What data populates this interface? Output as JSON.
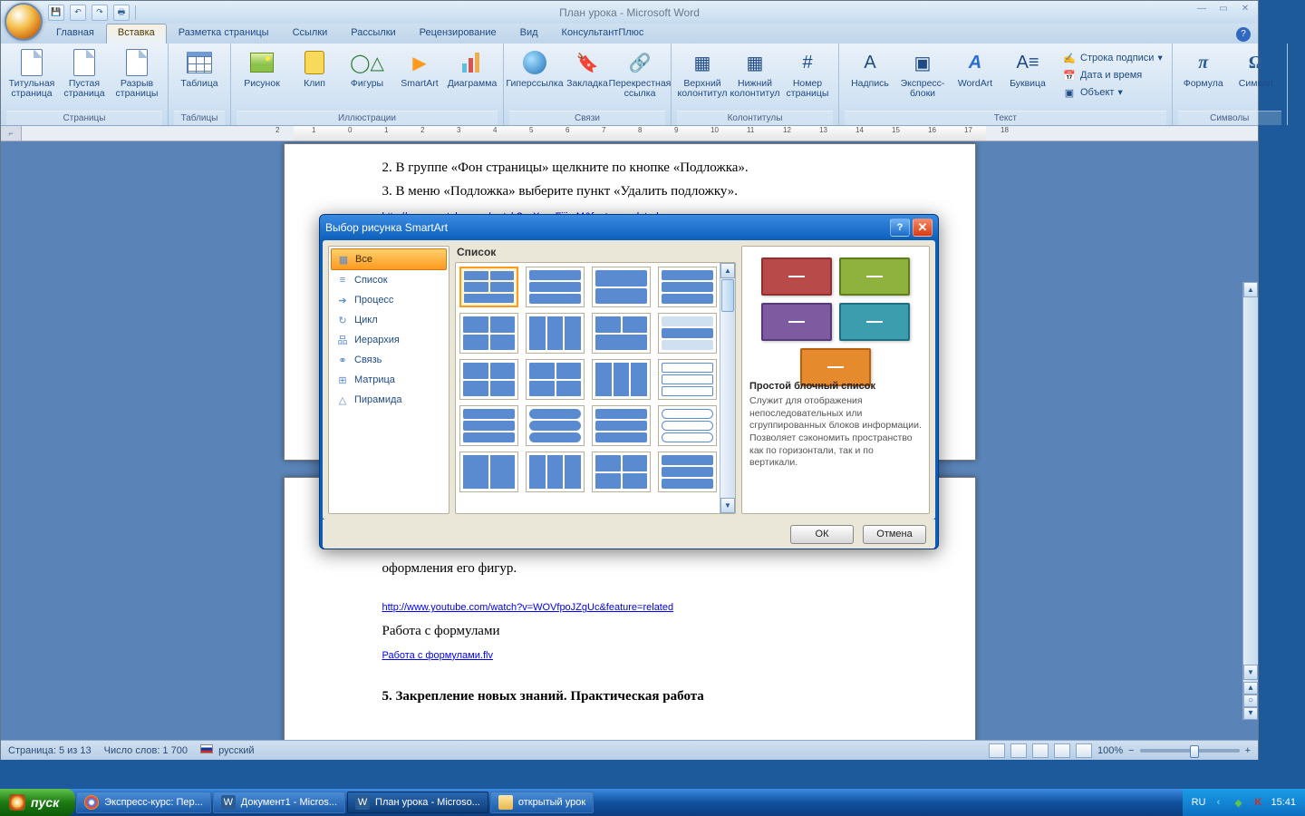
{
  "window": {
    "title": "План урока - Microsoft Word"
  },
  "qat": {
    "save": "💾",
    "undo": "↶",
    "redo": "↷",
    "print": "🖶"
  },
  "tabs": [
    "Главная",
    "Вставка",
    "Разметка страницы",
    "Ссылки",
    "Рассылки",
    "Рецензирование",
    "Вид",
    "КонсультантПлюс"
  ],
  "active_tab": 1,
  "ribbon": {
    "groups": {
      "pages": {
        "label": "Страницы",
        "items": [
          "Титульная страница",
          "Пустая страница",
          "Разрыв страницы"
        ]
      },
      "tables": {
        "label": "Таблицы",
        "items": [
          "Таблица"
        ]
      },
      "illus": {
        "label": "Иллюстрации",
        "items": [
          "Рисунок",
          "Клип",
          "Фигуры",
          "SmartArt",
          "Диаграмма"
        ]
      },
      "links": {
        "label": "Связи",
        "items": [
          "Гиперссылка",
          "Закладка",
          "Перекрестная ссылка"
        ]
      },
      "headerfooter": {
        "label": "Колонтитулы",
        "items": [
          "Верхний колонтитул",
          "Нижний колонтитул",
          "Номер страницы"
        ]
      },
      "text": {
        "label": "Текст",
        "items": [
          "Надпись",
          "Экспресс-блоки",
          "WordArt",
          "Буквица"
        ],
        "small": [
          "Строка подписи",
          "Дата и время",
          "Объект"
        ]
      },
      "symbols": {
        "label": "Символы",
        "items": [
          "Формула",
          "Символ"
        ]
      }
    }
  },
  "document": {
    "lines": [
      "2. В группе «Фон страницы» щелкните по кнопке «Подложка».",
      "3. В меню «Подложка» выберите пункт «Удалить подложку»."
    ],
    "link1": "http://www.youtube.com/watch?v=XsosFjijxrM&feature=related",
    "after_dialog": "оформления его фигур.",
    "link2": "http://www.youtube.com/watch?v=WOVfpoJZgUc&feature=related",
    "p3": "Работа с формулами",
    "link3": " Работа с формулами.flv",
    "p5": "5. Закрепление новых знаний. Практическая работа"
  },
  "dialog": {
    "title": "Выбор рисунка SmartArt",
    "categories": [
      "Все",
      "Список",
      "Процесс",
      "Цикл",
      "Иерархия",
      "Связь",
      "Матрица",
      "Пирамида"
    ],
    "gallery_title": "Список",
    "preview_title": "Простой блочный список",
    "preview_desc": "Служит для отображения непоследовательных или сгруппированных блоков информации. Позволяет сэкономить пространство как по горизонтали, так и по вертикали.",
    "ok": "ОК",
    "cancel": "Отмена"
  },
  "statusbar": {
    "page": "Страница: 5 из 13",
    "words": "Число слов: 1 700",
    "lang": "русский",
    "zoom": "100%"
  },
  "taskbar": {
    "start": "пуск",
    "items": [
      "Экспресс-курс: Пер...",
      "Документ1 - Micros...",
      "План урока - Microso...",
      "открытый урок"
    ],
    "active": 2,
    "lang": "RU",
    "time": "15:41"
  }
}
